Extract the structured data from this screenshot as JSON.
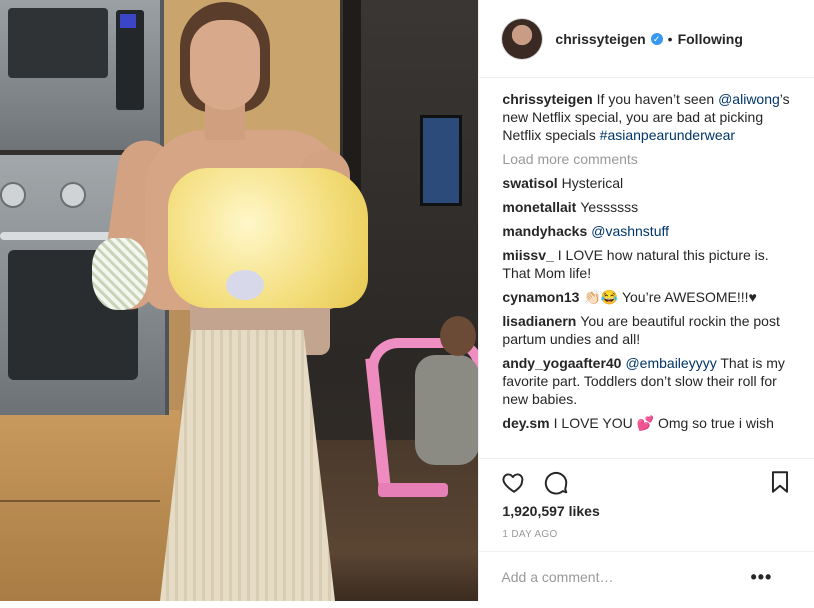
{
  "header": {
    "username": "chrissyteigen",
    "separator": "•",
    "follow_status": "Following",
    "verified_icon": "verified-badge-icon",
    "verified_color": "#3897f0"
  },
  "caption": {
    "username": "chrissyteigen",
    "text_1": "If you haven’t seen ",
    "mention": "@aliwong",
    "text_2": "’s new Netflix special, you are bad at picking Netflix specials ",
    "hashtag": "#asianpearunderwear"
  },
  "load_more": "Load more comments",
  "comments": [
    {
      "username": "swatisol",
      "text": "Hysterical"
    },
    {
      "username": "monetallait",
      "text": "Yessssss"
    },
    {
      "username": "mandyhacks",
      "mention": "@vashnstuff",
      "text": ""
    },
    {
      "username": "miissv_",
      "text": "I LOVE how natural this picture is. That Mom life!"
    },
    {
      "username": "cynamon13",
      "text": "👏🏻😂 You’re AWESOME!!!♥"
    },
    {
      "username": "lisadianern",
      "text": "You are beautiful rockin the post partum undies and all!"
    },
    {
      "username": "andy_yogaafter40",
      "mention": "@embaileyyyy",
      "text": " That is my favorite part. Toddlers don’t slow their roll for new babies."
    },
    {
      "username": "dey.sm",
      "text": "I LOVE YOU 💕 Omg so true i wish"
    }
  ],
  "actions": {
    "like_icon": "heart-icon",
    "comment_icon": "comment-bubble-icon",
    "save_icon": "bookmark-icon",
    "likes_count": "1,920,597",
    "likes_label": "likes",
    "timestamp": "1 DAY AGO"
  },
  "add_comment": {
    "placeholder": "Add a comment…",
    "more_icon": "more-options-icon",
    "more_glyph": "•••"
  },
  "colors": {
    "text": "#262626",
    "link": "#003569",
    "muted": "#999999",
    "border": "#efefef"
  }
}
